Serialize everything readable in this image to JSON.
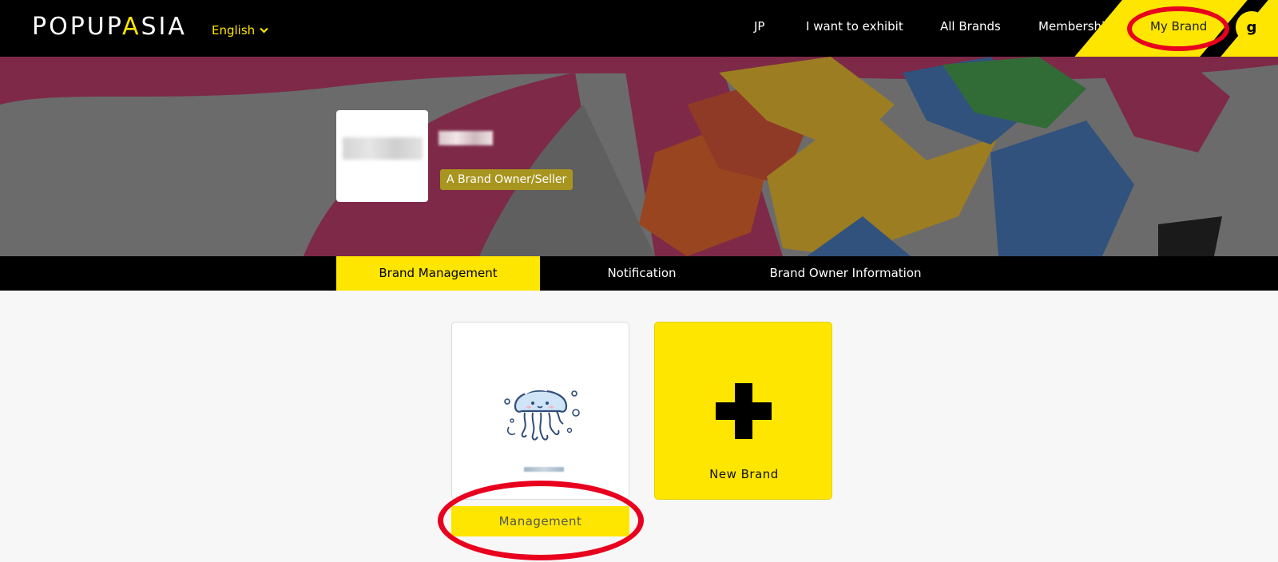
{
  "header": {
    "logo_main": "POPUP",
    "logo_accent": "A",
    "logo_end": "SIA",
    "language": "English",
    "nav": [
      "JP",
      "I want to exhibit",
      "All Brands",
      "Membership"
    ],
    "my_brand": "My Brand",
    "avatar_initial": "g"
  },
  "profile": {
    "role_badge": "A Brand Owner/Seller"
  },
  "tabs": [
    {
      "label": "Brand Management",
      "active": true
    },
    {
      "label": "Notification",
      "active": false
    },
    {
      "label": "Brand Owner Information",
      "active": false
    }
  ],
  "cards": {
    "manage_button": "Management",
    "new_brand_label": "New Brand"
  },
  "colors": {
    "brand_yellow": "#ffe600",
    "annotation_red": "#e8001e",
    "badge_olive": "#a8951f"
  }
}
